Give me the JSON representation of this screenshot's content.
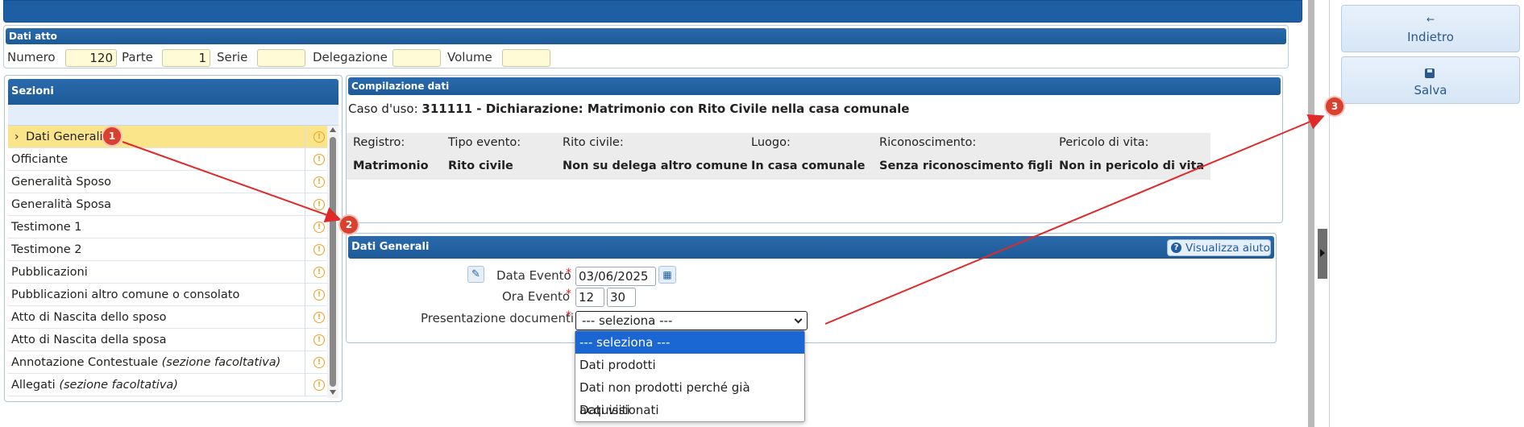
{
  "dati_atto": {
    "title": "Dati atto",
    "numero_label": "Numero",
    "numero_value": "120",
    "parte_label": "Parte",
    "parte_value": "1",
    "serie_label": "Serie",
    "serie_value": "",
    "delegazione_label": "Delegazione",
    "delegazione_value": "",
    "volume_label": "Volume",
    "volume_value": ""
  },
  "sezioni": {
    "title": "Sezioni",
    "items": [
      {
        "label": "Dati Generali",
        "selected": true
      },
      {
        "label": "Officiante"
      },
      {
        "label": "Generalità Sposo"
      },
      {
        "label": "Generalità Sposa"
      },
      {
        "label": "Testimone 1"
      },
      {
        "label": "Testimone 2"
      },
      {
        "label": "Pubblicazioni"
      },
      {
        "label": "Pubblicazioni altro comune o consolato"
      },
      {
        "label": "Atto di Nascita dello sposo"
      },
      {
        "label": "Atto di Nascita della sposa"
      },
      {
        "label": "Annotazione Contestuale",
        "note": "(sezione facoltativa)"
      },
      {
        "label": "Allegati",
        "note": "(sezione facoltativa)"
      }
    ]
  },
  "compilazione": {
    "title": "Compilazione dati",
    "caso_label": "Caso d'uso:",
    "caso_value": "311111 - Dichiarazione: Matrimonio con Rito Civile nella casa comunale",
    "headers": [
      "Registro:",
      "Tipo evento:",
      "Rito civile:",
      "Luogo:",
      "Riconoscimento:",
      "Pericolo di vita:"
    ],
    "values": [
      "Matrimonio",
      "Rito civile",
      "Non su delega altro comune",
      "In casa comunale",
      "Senza riconoscimento figli",
      "Non in pericolo di vita"
    ]
  },
  "dati_generali": {
    "title": "Dati Generali",
    "help_label": "Visualizza aiuto",
    "data_evento_label": "Data Evento",
    "data_evento_value": "03/06/2025",
    "ora_evento_label": "Ora Evento",
    "ora_hh": "12",
    "ora_mm": "30",
    "presentazione_label": "Presentazione documenti",
    "required_mark": "*",
    "select_value": "--- seleziona ---",
    "options": [
      "--- seleziona ---",
      "Dati prodotti",
      "Dati non prodotti perché già acquisiti",
      "Dati visionati"
    ]
  },
  "right_panel": {
    "back_icon": "arrow-left-icon",
    "back_label": "Indietro",
    "save_icon": "floppy-icon",
    "save_label": "Salva"
  },
  "annotations": [
    "1",
    "2",
    "3"
  ],
  "colors": {
    "header_blue": "#1e5fa3",
    "selected_row": "#fbe58a",
    "badge_red": "#d9412e",
    "arrow_red": "#e02a2a",
    "option_selected": "#1a66d2"
  }
}
